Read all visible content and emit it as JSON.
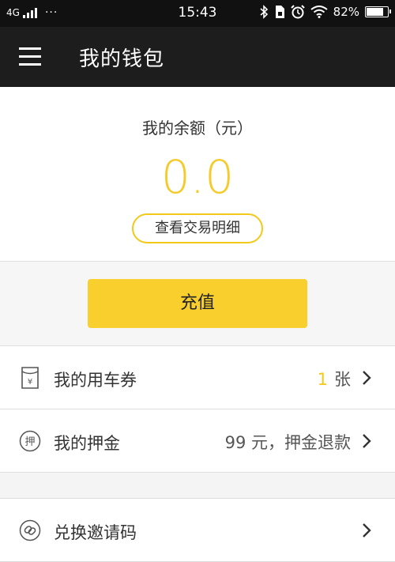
{
  "status_bar": {
    "network": "4G",
    "more": "···",
    "time": "15:43",
    "battery_text": "82%",
    "battery_level": 0.82,
    "icons": [
      "bluetooth-icon",
      "sim-lock-icon",
      "alarm-icon",
      "wifi-icon",
      "battery-charging-icon"
    ]
  },
  "header": {
    "title": "我的钱包",
    "menu_icon": "hamburger-menu-icon"
  },
  "balance": {
    "label": "我的余额（元）",
    "amount": "0.0",
    "detail_button": "查看交易明细",
    "accent_color": "#f5cb2b"
  },
  "recharge": {
    "button_label": "充值",
    "button_color": "#f8cf2d"
  },
  "list": {
    "coupon": {
      "label": "我的用车券",
      "count": "1",
      "unit": "张",
      "icon": "coupon-icon"
    },
    "deposit": {
      "label": "我的押金",
      "value": "99 元，押金退款",
      "icon": "deposit-icon",
      "icon_char": "押"
    },
    "invite": {
      "label": "兑换邀请码",
      "icon": "link-icon"
    }
  }
}
